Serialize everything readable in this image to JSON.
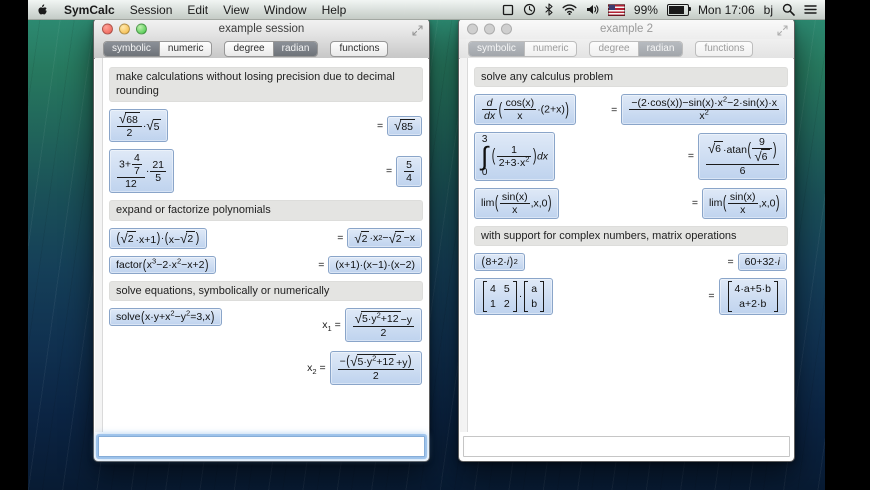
{
  "menubar": {
    "app": "SymCalc",
    "menus": [
      "Session",
      "Edit",
      "View",
      "Window",
      "Help"
    ],
    "status": {
      "battery": "99%",
      "clock": "Mon 17:06",
      "user": "bj"
    }
  },
  "windows": [
    {
      "title": "example session",
      "active": true,
      "toolbar": {
        "symbolic": "symbolic",
        "numeric": "numeric",
        "degree": "degree",
        "radian": "radian",
        "functions": "functions"
      },
      "content": [
        {
          "type": "header",
          "text": "make calculations without losing precision due to decimal rounding"
        },
        {
          "type": "row",
          "left": "@f{@s{68}}{2}·@s{5}",
          "results": [
            {
              "prefix": "=",
              "expr": "@s{85}"
            }
          ]
        },
        {
          "type": "row",
          "left": "@f{3+@f{4}{7}}{12}·@f{21}{5}",
          "results": [
            {
              "prefix": "=",
              "expr": "@f{5}{4}"
            }
          ]
        },
        {
          "type": "header",
          "text": "expand or factorize polynomials"
        },
        {
          "type": "row",
          "left": "@b{@s{2}·x+1}·@b{x−@s{2}}",
          "results": [
            {
              "prefix": "=",
              "expr": "@s{2}·x@p{2}−@s{2}−x"
            }
          ]
        },
        {
          "type": "row",
          "left": "factor@b{x@p{3}−2·x@p{2}−x+2}",
          "results": [
            {
              "prefix": "=",
              "expr": "(x+1)·(x−1)·(x−2)"
            }
          ]
        },
        {
          "type": "header",
          "text": "solve equations, symbolically or numerically"
        },
        {
          "type": "row",
          "left": "solve@b{x·y+x@p{2}−y@p{2}=3,x}",
          "results": [
            {
              "prefix": "x@q{1} =",
              "expr": "@f{@s{5·y@p{2}+12}−y}{2}"
            },
            {
              "prefix": "x@q{2} =",
              "expr": "@f{−@b{@s{5·y@p{2}+12}+y}}{2}"
            }
          ]
        }
      ]
    },
    {
      "title": "example 2",
      "active": false,
      "toolbar": {
        "symbolic": "symbolic",
        "numeric": "numeric",
        "degree": "degree",
        "radian": "radian",
        "functions": "functions"
      },
      "content": [
        {
          "type": "header",
          "text": "solve any calculus problem"
        },
        {
          "type": "row",
          "left": "@f{@i{d}}{@i{dx}}@b{@f{cos(x)}{x}·(2+x)}",
          "results": [
            {
              "prefix": "=",
              "expr": "@f{−(2·cos(x))−sin(x)·x@p{2}−2·sin(x)·x}{x@p{2}}"
            }
          ]
        },
        {
          "type": "row",
          "left": "@I{0}{3}{@b{@f{1}{2+3·x@p{2}}}@i{dx}}",
          "results": [
            {
              "prefix": "=",
              "expr": "@f{@s{6}·atan@b{@f{9}{@s{6}}}}{6}"
            }
          ]
        },
        {
          "type": "row",
          "left": "lim@b{@f{sin(x)}{x},x,0}",
          "results": [
            {
              "prefix": "=",
              "expr": "lim@b{@f{sin(x)}{x},x,0}"
            }
          ]
        },
        {
          "type": "header",
          "text": "with support for complex numbers, matrix operations"
        },
        {
          "type": "row",
          "left": "@b{8+2·@i{i}}@p{2}",
          "results": [
            {
              "prefix": "=",
              "expr": "60+32·@i{i}"
            }
          ]
        },
        {
          "type": "row",
          "left": "@m{4|5;1|2}·@m{a;b}",
          "results": [
            {
              "prefix": "=",
              "expr": "@m{4·a+5·b;a+2·b}"
            }
          ]
        }
      ]
    }
  ],
  "colors": {
    "expr_box_bg": "#c9d9ef",
    "expr_box_border": "#8aa5c9",
    "selected_segment": "#75797f",
    "focus_ring": "#7faede",
    "wallpaper_top": "#2f9078",
    "wallpaper_bottom": "#081b33"
  },
  "icons": [
    "apple-logo",
    "shape-icon",
    "time-machine-icon",
    "bluetooth-icon",
    "wifi-icon",
    "volume-icon",
    "us-flag-icon",
    "battery-icon",
    "search-icon",
    "list-icon",
    "fullscreen-icon",
    "close-button",
    "minimize-button",
    "zoom-button"
  ]
}
